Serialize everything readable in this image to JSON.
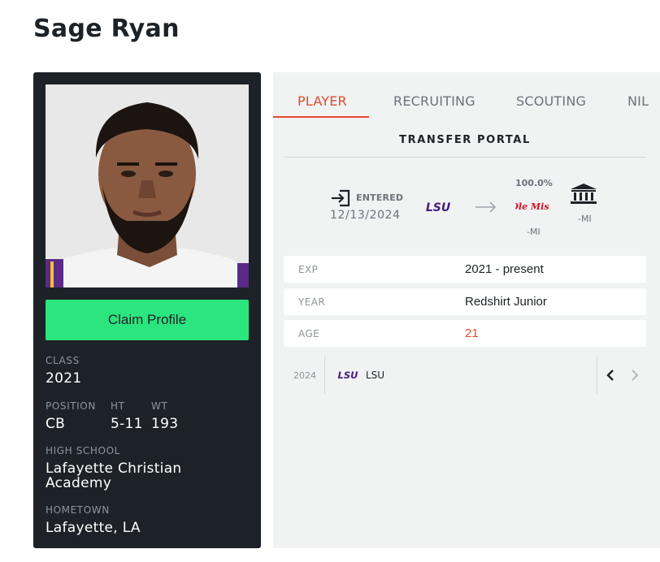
{
  "page": {
    "title": "Sage Ryan"
  },
  "profile": {
    "claim_label": "Claim Profile",
    "class_label": "CLASS",
    "class_value": "2021",
    "position_label": "POSITION",
    "position_value": "CB",
    "ht_label": "HT",
    "ht_value": "5-11",
    "wt_label": "WT",
    "wt_value": "193",
    "high_school_label": "HIGH SCHOOL",
    "high_school_value_line1": "Lafayette Christian",
    "high_school_value_line2": "Academy",
    "hometown_label": "HOMETOWN",
    "hometown_value": "Lafayette, LA"
  },
  "tabs": [
    {
      "label": "PLAYER",
      "active": true
    },
    {
      "label": "RECRUITING",
      "active": false
    },
    {
      "label": "SCOUTING",
      "active": false
    },
    {
      "label": "NIL",
      "active": false
    }
  ],
  "portal": {
    "title": "TRANSFER PORTAL",
    "entered_label": "ENTERED",
    "entered_date": "12/13/2024",
    "from_team_logo_text": "LSU",
    "percent": "100.0%",
    "to_team_logo_text": "Ole Miss",
    "to_team_suffix": "-MI",
    "inst_suffix": "-MI"
  },
  "info": [
    {
      "key": "EXP",
      "value": "2021 - present"
    },
    {
      "key": "YEAR",
      "value": "Redshirt Junior"
    },
    {
      "key": "AGE",
      "value": "21"
    }
  ],
  "history": {
    "year": "2024",
    "logo_text": "LSU",
    "team": "LSU"
  },
  "icons": {
    "entered": "sign-in-icon",
    "arrow": "arrow-right-icon",
    "institution": "institution-icon",
    "prev": "chevron-left-icon",
    "next": "chevron-right-icon"
  },
  "colors": {
    "card_bg": "#1d2228",
    "claim_green": "#2be57f",
    "accent_red": "#e24a2f",
    "lsu_purple": "#461d7c",
    "olemiss_red": "#ce1126"
  }
}
